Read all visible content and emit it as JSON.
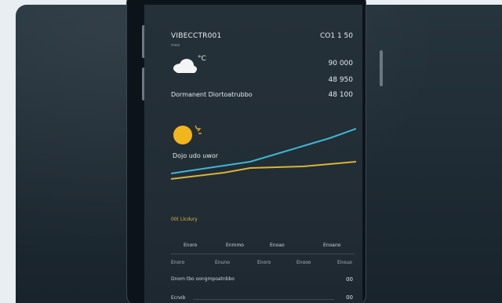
{
  "app": {
    "title": "VIBECCTR001",
    "subtitle": "mea",
    "top_right_value": "CO1 1 50",
    "weather": {
      "temp_symbol": "°C",
      "values": [
        "90 000",
        "48 950",
        "48 100"
      ],
      "description": "Dormanent Diortoatrubbo"
    },
    "sun_label": "Dojo udo uwor",
    "section_label": "00( Llcdury",
    "table": {
      "headers": [
        "Enoro",
        "Enmmo",
        "Enoao",
        "Enoano"
      ],
      "row": [
        "Enoro",
        "Enuno",
        "Enoro",
        "Enooo",
        "Enouo"
      ]
    },
    "stats": [
      {
        "label": "Dnom tbo oongmpoatnbbo",
        "value": "00"
      },
      {
        "label": "Ecnob",
        "value": "00"
      }
    ]
  },
  "chart_data": {
    "type": "line",
    "title": "",
    "xlabel": "",
    "ylabel": "",
    "series": [
      {
        "color": "#3fb6d4",
        "values": [
          35,
          40,
          45,
          50,
          60,
          70,
          80,
          92
        ]
      },
      {
        "color": "#d8b43a",
        "values": [
          28,
          32,
          36,
          42,
          43,
          44,
          47,
          50
        ]
      }
    ],
    "ylim": [
      0,
      100
    ],
    "grid": false
  },
  "colors": {
    "accent_blue": "#3fb6d4",
    "accent_yellow": "#d8b43a",
    "sun": "#f2b51d",
    "background": "#222d35"
  }
}
